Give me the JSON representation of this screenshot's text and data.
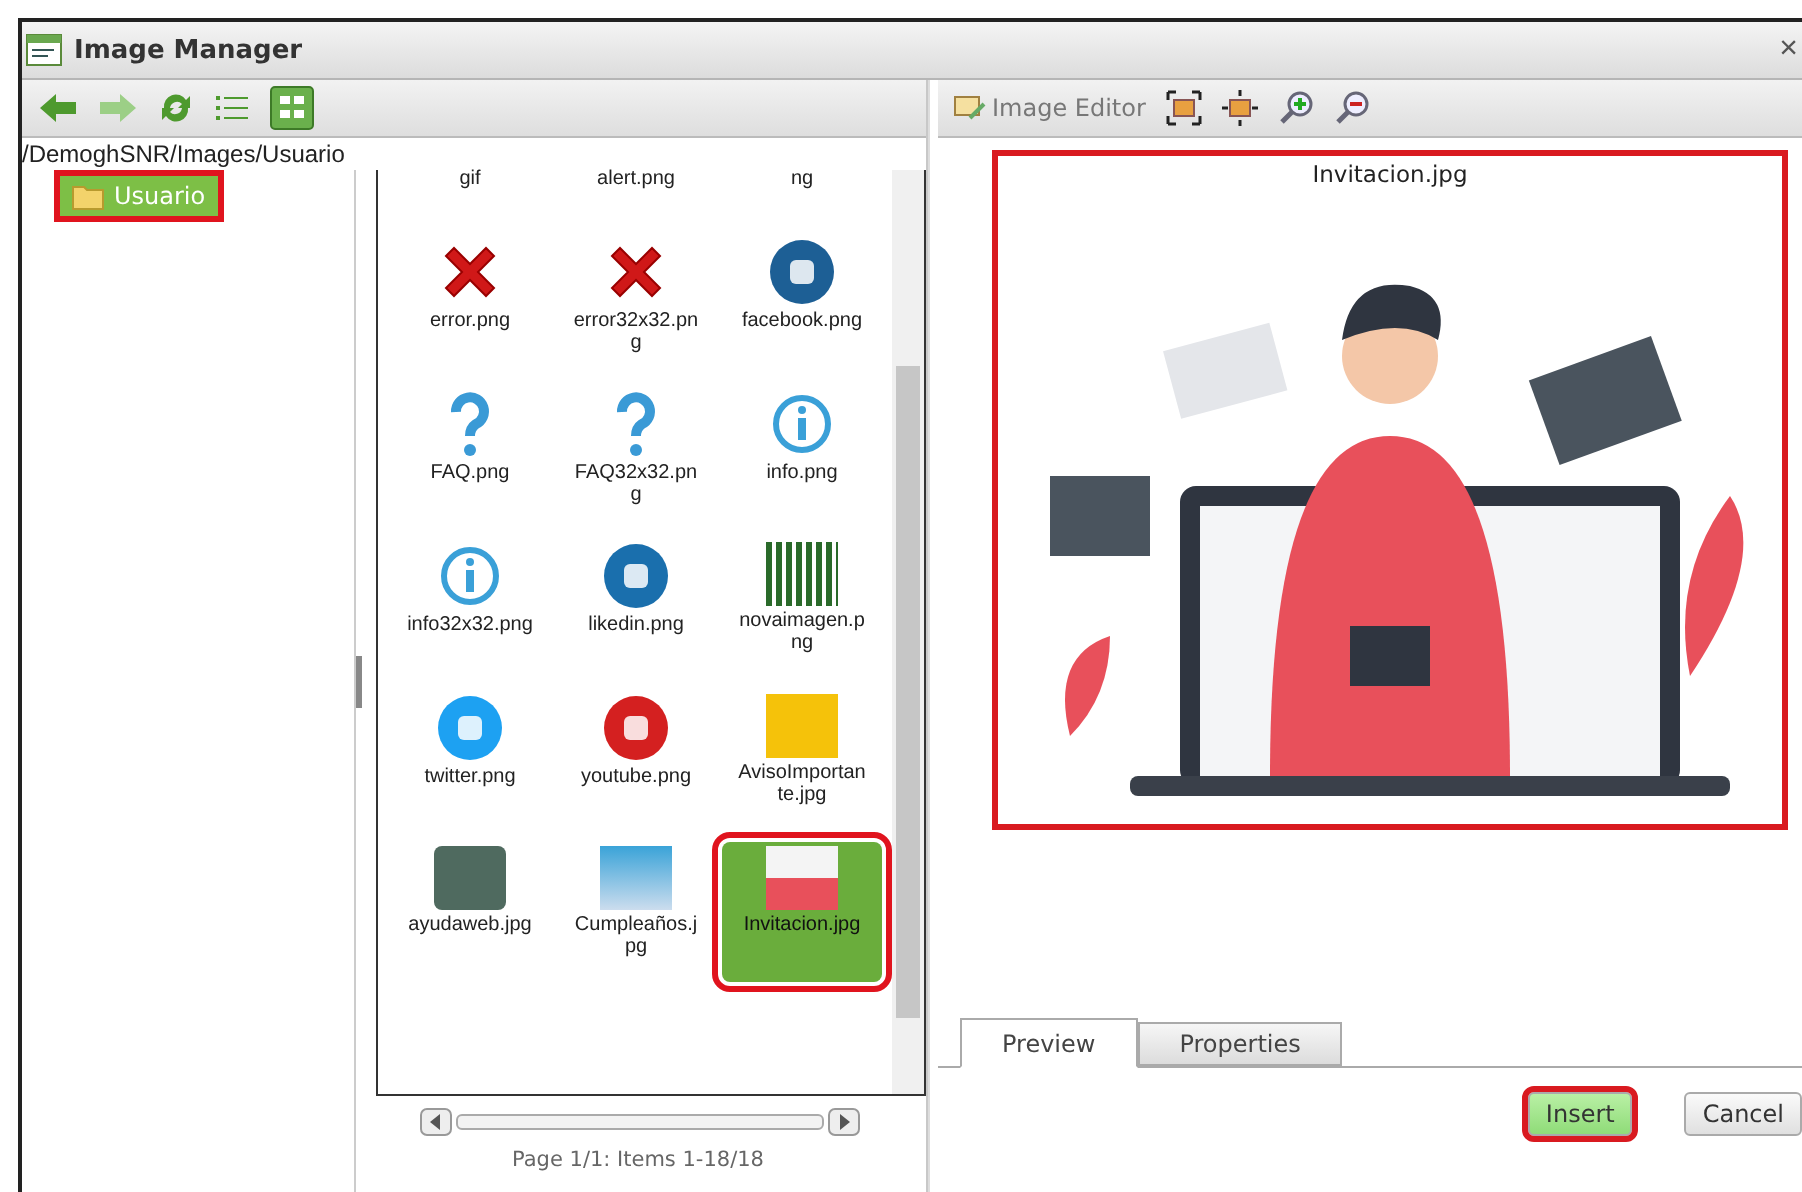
{
  "window": {
    "title": "Image Manager",
    "close": "×"
  },
  "path": "/DemoghSNR/Images/Usuario",
  "tree": [
    {
      "label": "Usuario",
      "selected": true
    }
  ],
  "files": [
    {
      "name": "gif",
      "kind": "partial",
      "selected": false
    },
    {
      "name": "alert.png",
      "kind": "partial",
      "selected": false
    },
    {
      "name": "ng",
      "kind": "partial",
      "selected": false
    },
    {
      "name": "error.png",
      "kind": "error",
      "selected": false
    },
    {
      "name": "error32x32.png",
      "kind": "error",
      "selected": false
    },
    {
      "name": "facebook.png",
      "kind": "facebook",
      "selected": false
    },
    {
      "name": "FAQ.png",
      "kind": "question",
      "selected": false
    },
    {
      "name": "FAQ32x32.png",
      "kind": "question",
      "selected": false
    },
    {
      "name": "info.png",
      "kind": "info",
      "selected": false
    },
    {
      "name": "info32x32.png",
      "kind": "info",
      "selected": false
    },
    {
      "name": "likedin.png",
      "kind": "linkedin",
      "selected": false
    },
    {
      "name": "novaimagen.png",
      "kind": "logo",
      "selected": false
    },
    {
      "name": "twitter.png",
      "kind": "twitter",
      "selected": false
    },
    {
      "name": "youtube.png",
      "kind": "youtube",
      "selected": false
    },
    {
      "name": "AvisoImportante.jpg",
      "kind": "notice",
      "selected": false
    },
    {
      "name": "ayudaweb.jpg",
      "kind": "banner",
      "selected": false
    },
    {
      "name": "Cumpleaños.jpg",
      "kind": "cake",
      "selected": false
    },
    {
      "name": "Invitacion.jpg",
      "kind": "photo",
      "selected": true
    }
  ],
  "pager": "Page 1/1: Items 1-18/18",
  "editor": {
    "label": "Image Editor"
  },
  "preview": {
    "filename": "Invitacion.jpg"
  },
  "tabs": [
    {
      "label": "Preview",
      "selected": true
    },
    {
      "label": "Properties",
      "selected": false
    }
  ],
  "buttons": [
    {
      "label": "Insert",
      "kind": "primary"
    },
    {
      "label": "Cancel",
      "kind": "secondary"
    }
  ]
}
